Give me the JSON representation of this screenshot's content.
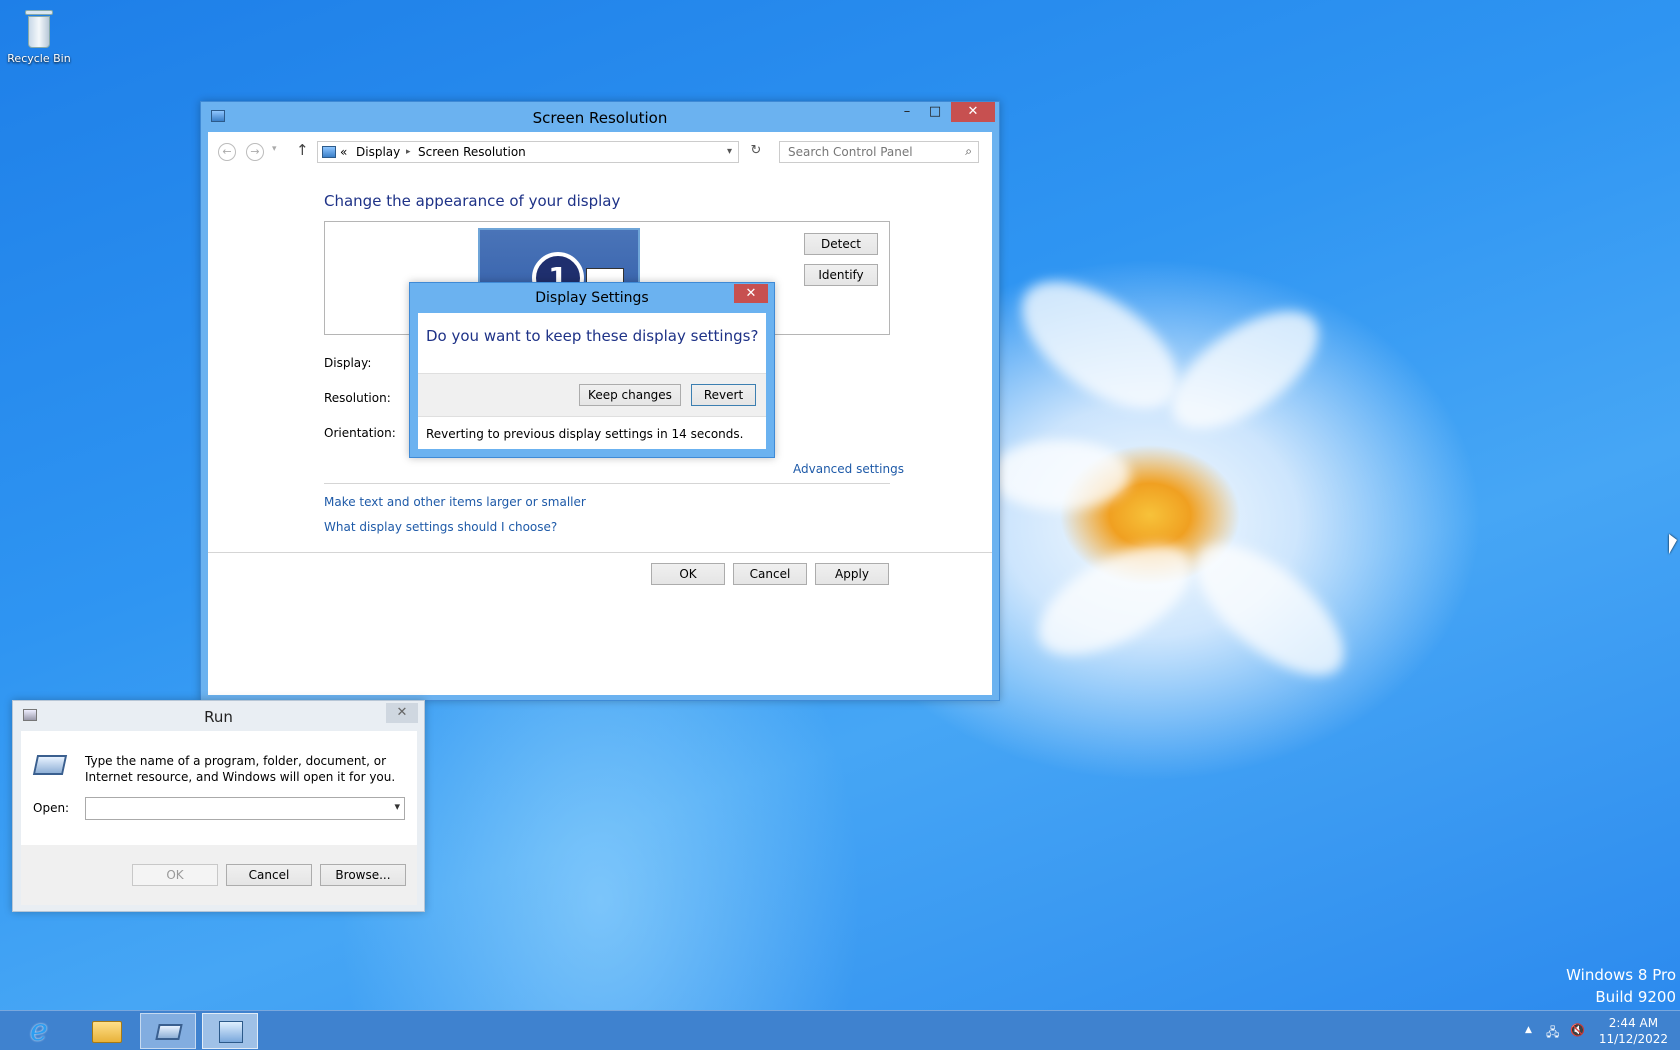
{
  "desktop": {
    "recycle_bin_label": "Recycle Bin",
    "watermark_line1": "Windows 8 Pro",
    "watermark_line2": "Build 9200"
  },
  "screen_resolution": {
    "title": "Screen Resolution",
    "breadcrumb": [
      "Display",
      "Screen Resolution"
    ],
    "breadcrumb_sep": "«",
    "search_placeholder": "Search Control Panel",
    "heading": "Change the appearance of your display",
    "monitor_number": "1",
    "detect_label": "Detect",
    "identify_label": "Identify",
    "display_label": "Display:",
    "resolution_label": "Resolution:",
    "orientation_label": "Orientation:",
    "advanced_link": "Advanced settings",
    "text_size_link": "Make text and other items larger or smaller",
    "help_link": "What display settings should I choose?",
    "ok_label": "OK",
    "cancel_label": "Cancel",
    "apply_label": "Apply"
  },
  "display_settings": {
    "title": "Display Settings",
    "question": "Do you want to keep these display settings?",
    "keep_label": "Keep changes",
    "revert_label": "Revert",
    "status": "Reverting to previous display settings in 14 seconds."
  },
  "run": {
    "title": "Run",
    "description": "Type the name of a program, folder, document, or Internet resource, and Windows will open it for you.",
    "open_label": "Open:",
    "open_value": "",
    "ok_label": "OK",
    "cancel_label": "Cancel",
    "browse_label": "Browse..."
  },
  "taskbar": {
    "time": "2:44 AM",
    "date": "11/12/2022"
  },
  "colors": {
    "accent": "#1e3287",
    "link": "#1e5aa8",
    "close_button": "#c75050",
    "window_frame": "#6bb2f0"
  }
}
